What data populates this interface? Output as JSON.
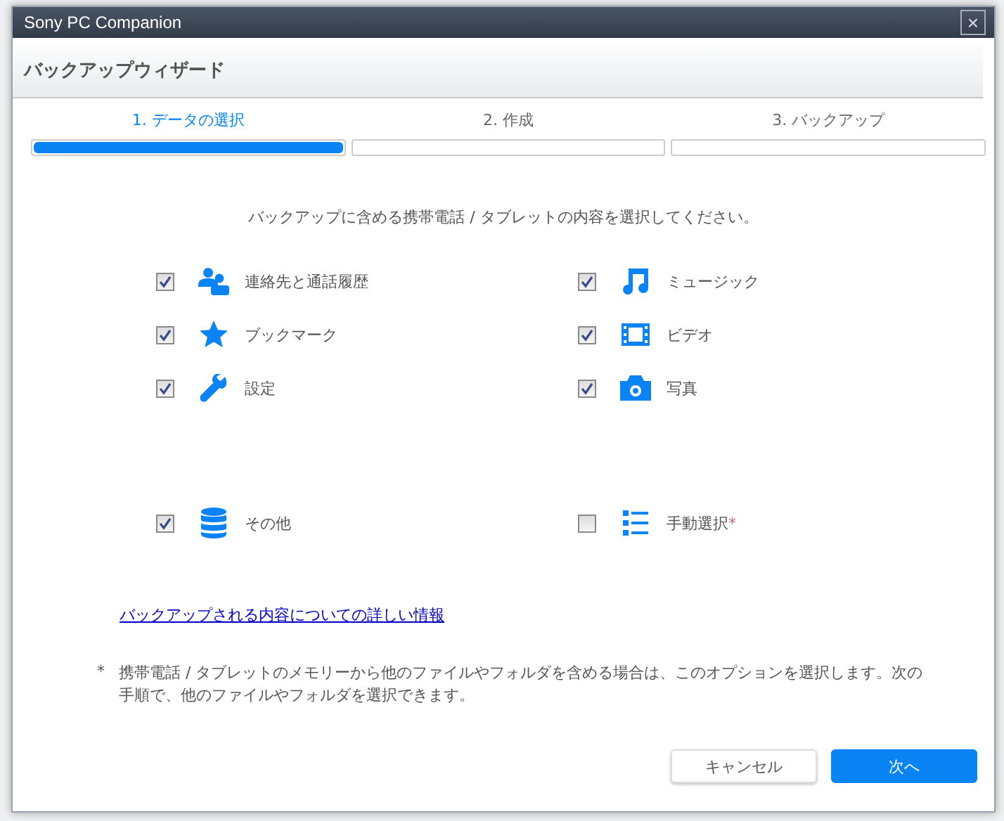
{
  "window": {
    "title": "Sony PC Companion",
    "close": "×"
  },
  "wizard_title": "バックアップウィザード",
  "steps": [
    {
      "label": "1. データの選択",
      "selected": true
    },
    {
      "label": "2. 作成",
      "selected": false
    },
    {
      "label": "3. バックアップ",
      "selected": false
    }
  ],
  "instruction": "バックアップに含める携帯電話 / タブレットの内容を選択してください。",
  "items": [
    {
      "label": "連絡先と通話履歴",
      "checked": true
    },
    {
      "label": "ミュージック",
      "checked": true
    },
    {
      "label": "ブックマーク",
      "checked": true
    },
    {
      "label": "ビデオ",
      "checked": true
    },
    {
      "label": "設定",
      "checked": true
    },
    {
      "label": "写真",
      "checked": true
    },
    {
      "label": "その他",
      "checked": true
    },
    {
      "label": "手動選択",
      "mark": "*",
      "checked": false
    }
  ],
  "details_link": "バックアップされる内容についての詳しい情報",
  "footnote": {
    "mark": "*",
    "text": "携帯電話 / タブレットのメモリーから他のファイルやフォルダを含める場合は、このオプションを選択します。次の手順で、他のファイルやフォルダを選択できます。"
  },
  "buttons": [
    {
      "label": "キャンセル",
      "kind": "secondary"
    },
    {
      "label": "次へ",
      "kind": "primary"
    }
  ]
}
